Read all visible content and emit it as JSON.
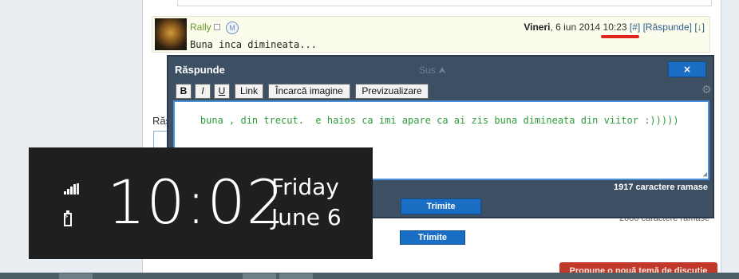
{
  "post": {
    "username": "Rally",
    "medal_letter": "M",
    "day": "Vineri",
    "date": ", 6 iun 2014 ",
    "time": "10:23",
    "permalink": "[#]",
    "reply_link": "[Răspunde]",
    "down_link": "[↓]",
    "text": "Buna inca dimineata..."
  },
  "background_reply": {
    "label": "Răs",
    "char_count": "2000 caractere ramase",
    "submit_label": "Trimite"
  },
  "reply_popup": {
    "title": "Răspunde",
    "scroll_up_label": "Sus ⮝",
    "close_label": "×",
    "toolbar": {
      "bold": "B",
      "italic": "I",
      "underline": "U",
      "link": "Link",
      "upload": "Încarcă imagine",
      "preview": "Previzualizare"
    },
    "message": "buna , din trecut.  e haios ca imi apare ca ai zis buna dimineata din viitor :)))))",
    "char_count": "1917 caractere ramase",
    "submit_label": "Trimite"
  },
  "new_topic_button": "Propune o nouă temă de discuție",
  "lock_clock": {
    "time": "10:02",
    "day": "Friday",
    "date": "June 6",
    "signal_icon": "signal-icon",
    "battery_icon": "battery-charging-icon"
  },
  "colors": {
    "accent_blue": "#1a6fc4",
    "popup_bg": "#3d4f63",
    "message_text": "#2e9b3a",
    "username": "#6a9a2a",
    "highlight_underline": "#e0251f",
    "new_topic_button": "#c0392b",
    "clock_bg": "#1f1f1f"
  }
}
